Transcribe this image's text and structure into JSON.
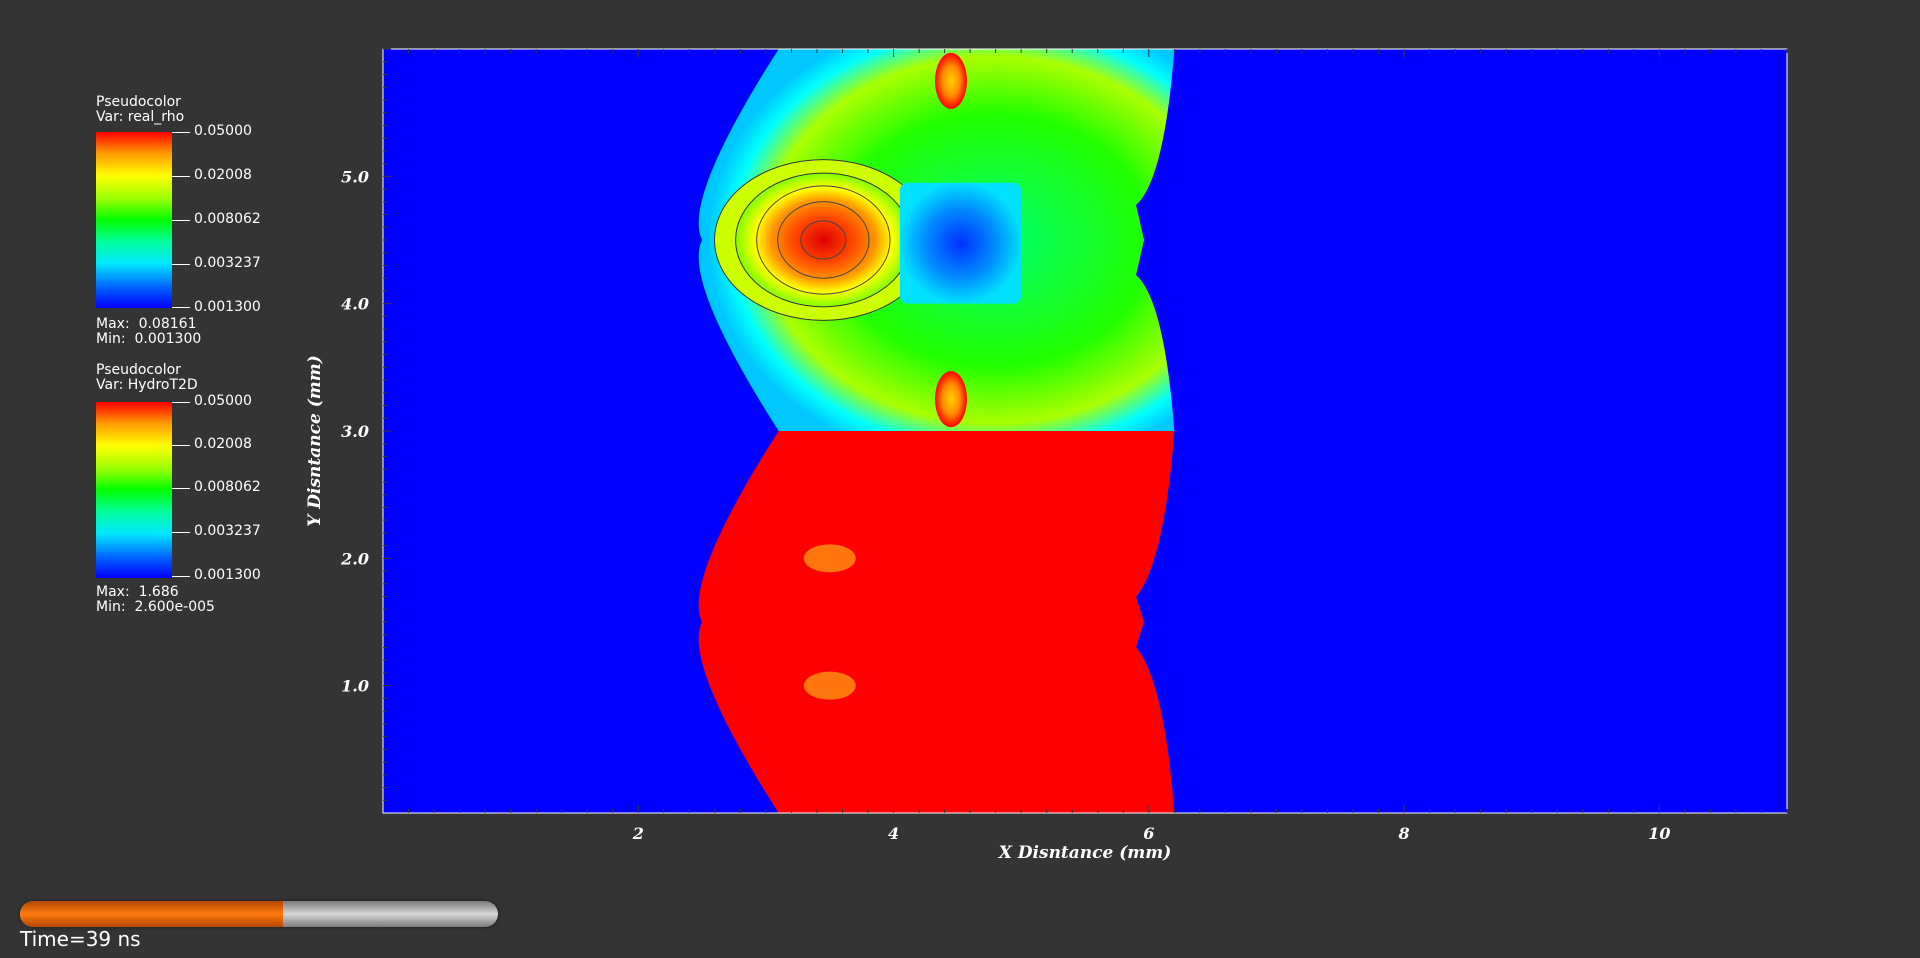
{
  "legends": [
    {
      "title": "Pseudocolor",
      "var": "Var: real_rho",
      "ticks": [
        "0.05000",
        "0.02008",
        "0.008062",
        "0.003237",
        "0.001300"
      ],
      "max_label": "Max:",
      "max_value": "0.08161",
      "min_label": "Min:",
      "min_value": "0.001300"
    },
    {
      "title": "Pseudocolor",
      "var": "Var: HydroT2D",
      "ticks": [
        "0.05000",
        "0.02008",
        "0.008062",
        "0.003237",
        "0.001300"
      ],
      "max_label": "Max:",
      "max_value": "1.686",
      "min_label": "Min:",
      "min_value": "2.600e-005"
    }
  ],
  "chart_data": {
    "type": "heatmap",
    "xlabel": "X Disntance (mm)",
    "ylabel": "Y Disntance (mm)",
    "xlim": [
      0,
      11
    ],
    "ylim": [
      0,
      6
    ],
    "x_ticks": [
      2,
      4,
      6,
      8,
      10
    ],
    "x_tick_labels": [
      "2",
      "4",
      "6",
      "8",
      "10"
    ],
    "y_ticks": [
      1,
      2,
      3,
      4,
      5
    ],
    "y_tick_labels": [
      "1.0",
      "2.0",
      "3.0",
      "4.0",
      "5.0"
    ],
    "colormap": [
      "#0000ff",
      "#00e6ff",
      "#00ff00",
      "#ffff00",
      "#ff0000"
    ],
    "background_color": "#0000ff",
    "upper_half_variable": "real_rho",
    "lower_half_variable": "HydroT2D",
    "shock_front_x_left": 2.5,
    "shock_front_x_right": 6.2
  },
  "time_slider": {
    "progress": 0.55,
    "label": "Time=39 ns"
  },
  "colors": {
    "background": "#343434",
    "slider_fill": "#ff7a10",
    "slider_track": "#c0c0c0"
  }
}
